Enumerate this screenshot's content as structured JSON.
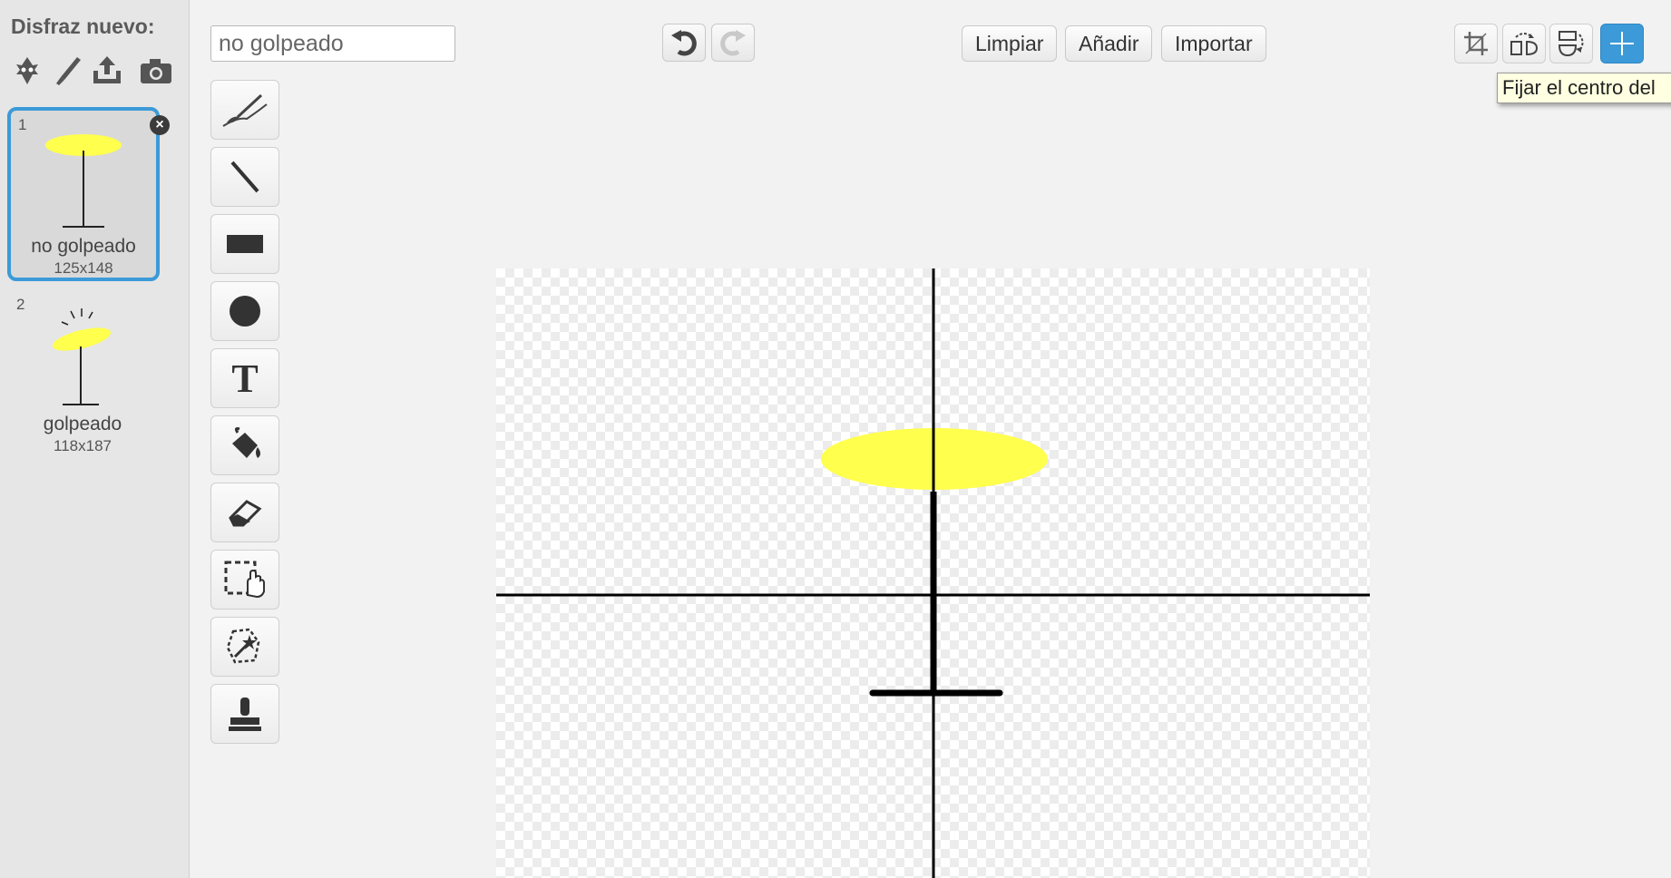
{
  "sidebar": {
    "title": "Disfraz nuevo:",
    "new_icons": [
      "sprite-library-icon",
      "paint-brush-icon",
      "upload-icon",
      "camera-icon"
    ],
    "costumes": [
      {
        "number": "1",
        "name": "no golpeado",
        "size": "125x148",
        "selected": true
      },
      {
        "number": "2",
        "name": "golpeado",
        "size": "118x187",
        "selected": false
      }
    ],
    "delete_glyph": "×"
  },
  "editor": {
    "costume_name_value": "no golpeado",
    "history": {
      "undo_icon": "undo-icon",
      "redo_icon": "redo-icon"
    },
    "actions": {
      "clear": "Limpiar",
      "add": "Añadir",
      "import": "Importar"
    },
    "right_tools": [
      "crop-icon",
      "flip-horizontal-icon",
      "flip-vertical-icon",
      "set-center-icon"
    ],
    "tooltip": "Fijar el centro del",
    "tools": [
      "brush-icon",
      "line-icon",
      "rectangle-icon",
      "ellipse-icon",
      "text-icon",
      "fill-icon",
      "eraser-icon",
      "select-icon",
      "reshape-select-icon",
      "stamp-icon"
    ],
    "text_tool_glyph": "T"
  },
  "colors": {
    "accent": "#3c9ad8",
    "costume_yellow": "#ffff4d",
    "tooltip_bg": "#ffffe1"
  }
}
